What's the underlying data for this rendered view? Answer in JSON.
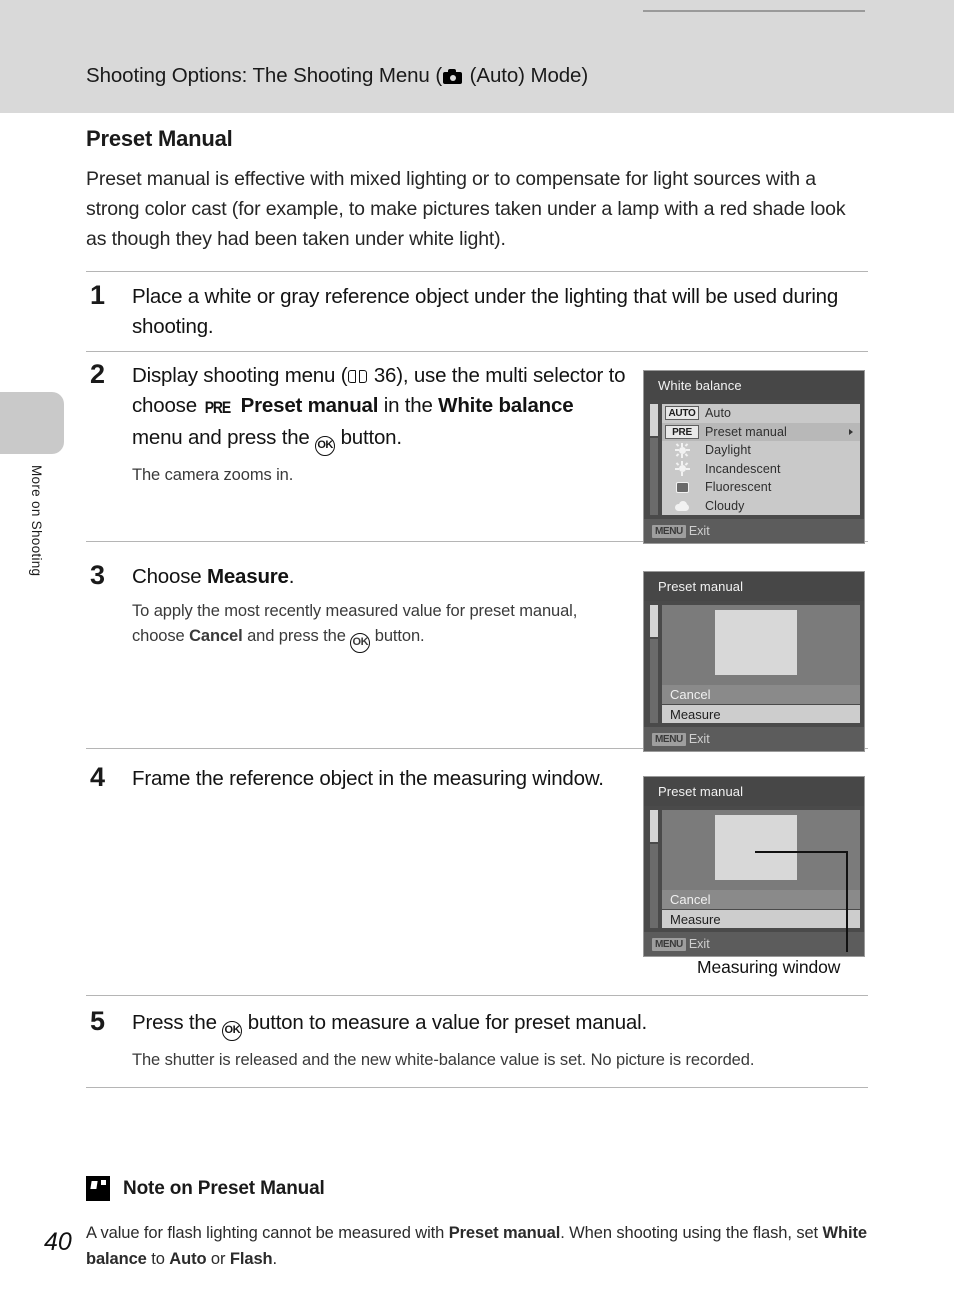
{
  "header": {
    "title_before": "Shooting Options: The Shooting Menu (",
    "title_after": " (Auto) Mode)",
    "camera_icon": "camera-icon"
  },
  "sidebar": {
    "tab_label": "More on Shooting"
  },
  "section": {
    "title": "Preset Manual",
    "intro": "Preset manual is effective with mixed lighting or to compensate for light sources with a strong color cast (for example, to make pictures taken under a lamp with a red shade look as though they had been taken under white light)."
  },
  "steps": [
    {
      "number": "1",
      "text": "Place a white or gray reference object under the lighting that will be used during shooting.",
      "sub": ""
    },
    {
      "number": "2",
      "part1": "Display shooting menu (",
      "page_ref": "36",
      "part2": "), use the multi selector to choose ",
      "pre_glyph": "PRE",
      "bold1": "Preset manual",
      "part3": " in the ",
      "bold2": "White balance",
      "part4": " menu and press the ",
      "ok_glyph": "OK",
      "part5": " button.",
      "sub": "The camera zooms in."
    },
    {
      "number": "3",
      "part1": "Choose ",
      "bold1": "Measure",
      "part2": ".",
      "sub_part1": "To apply the most recently measured value for preset manual, choose ",
      "sub_bold": "Cancel",
      "sub_part2": " and press the ",
      "sub_ok": "OK",
      "sub_part3": " button."
    },
    {
      "number": "4",
      "text": "Frame the reference object in the measuring window.",
      "sub": ""
    },
    {
      "number": "5",
      "part1": "Press the ",
      "ok_glyph": "OK",
      "part2": " button to measure a value for preset manual.",
      "sub": "The shutter is released and the new white-balance value is set. No picture is recorded."
    }
  ],
  "lcd_white_balance": {
    "title": "White balance",
    "battery_icon": "battery-icon",
    "rows": [
      {
        "badge": "AUTO",
        "label": "Auto",
        "icon": "",
        "selected": false,
        "arrow": false
      },
      {
        "badge": "PRE",
        "label": "Preset manual",
        "icon": "",
        "selected": true,
        "arrow": true
      },
      {
        "badge": "",
        "label": "Daylight",
        "icon": "sun-icon",
        "selected": false,
        "arrow": false
      },
      {
        "badge": "",
        "label": "Incandescent",
        "icon": "bulb-icon",
        "selected": false,
        "arrow": false
      },
      {
        "badge": "",
        "label": "Fluorescent",
        "icon": "tube-icon",
        "selected": false,
        "arrow": false
      },
      {
        "badge": "",
        "label": "Cloudy",
        "icon": "cloud-icon",
        "selected": false,
        "arrow": false
      }
    ],
    "footer_badge": "MENU",
    "footer_label": "Exit"
  },
  "lcd_preset_manual_3": {
    "title": "Preset manual",
    "cancel_label": "Cancel",
    "measure_label": "Measure",
    "footer_badge": "MENU",
    "footer_label": "Exit"
  },
  "lcd_preset_manual_4": {
    "title": "Preset manual",
    "cancel_label": "Cancel",
    "measure_label": "Measure",
    "footer_badge": "MENU",
    "footer_label": "Exit",
    "callout_label": "Measuring window"
  },
  "note": {
    "icon": "checkmark-box-icon",
    "title": "Note on Preset Manual",
    "part1": "A value for flash lighting cannot be measured with ",
    "bold1": "Preset manual",
    "part2": ". When shooting using the flash, set ",
    "bold2": "White balance",
    "part3": " to ",
    "bold3": "Auto",
    "part4": " or ",
    "bold4": "Flash",
    "part5": "."
  },
  "page_number": "40",
  "colors": {
    "header_band": "#d9d9d9",
    "sidebar_tab": "#c9c9c9",
    "lcd_bg": "#4a4a4a",
    "lcd_highlight": "#b8b8b8"
  }
}
